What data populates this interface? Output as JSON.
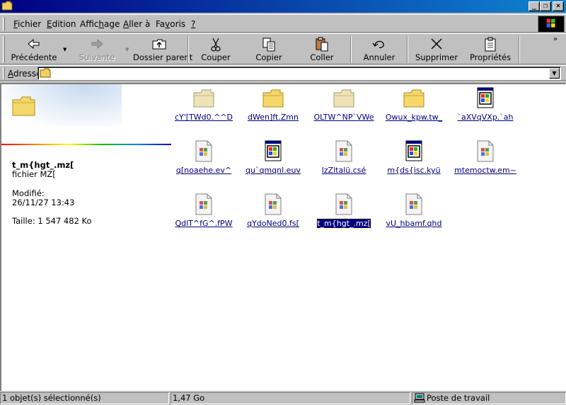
{
  "menu": {
    "items": [
      {
        "pre": "",
        "u": "F",
        "post": "ichier"
      },
      {
        "pre": "",
        "u": "E",
        "post": "dition"
      },
      {
        "pre": "Affic",
        "u": "h",
        "post": "age"
      },
      {
        "pre": "",
        "u": "A",
        "post": "ller à"
      },
      {
        "pre": "Fa",
        "u": "v",
        "post": "oris"
      },
      {
        "pre": "",
        "u": "?",
        "post": ""
      }
    ]
  },
  "toolbar": {
    "back": "Précédente",
    "forward": "Suivante",
    "up": "Dossier parent",
    "cut": "Couper",
    "copy": "Copier",
    "paste": "Coller",
    "undo": "Annuler",
    "delete": "Supprimer",
    "properties": "Propriétés"
  },
  "address": {
    "label_pre": "A",
    "label_post": "dresse",
    "value": ""
  },
  "panel": {
    "file_name": "t_m{hgt_.mz[",
    "file_type": "fichier MZ[",
    "modified_label": "Modifié:",
    "modified_value": "26/11/27 13:43",
    "size": "Taille: 1 547 482 Ko"
  },
  "files": [
    {
      "name": "cY'[TWd0.^^D",
      "kind": "folder"
    },
    {
      "name": "dWen]ft.Zmn",
      "kind": "folder-open"
    },
    {
      "name": "OLTW^NP`VWe",
      "kind": "folder"
    },
    {
      "name": "Owux_kpw.tw_",
      "kind": "folder-open"
    },
    {
      "name": "`aXVqVXp.`ah",
      "kind": "app"
    },
    {
      "name": "q[noaehe.ev^",
      "kind": "doc"
    },
    {
      "name": "qu`qmqnl.euv",
      "kind": "app"
    },
    {
      "name": "lzZltalü.csé",
      "kind": "doc"
    },
    {
      "name": "m{ds{isc.kyü",
      "kind": "app"
    },
    {
      "name": "mtemoctw.em~",
      "kind": "doc"
    },
    {
      "name": "QdlT^fG^.fPW",
      "kind": "doc"
    },
    {
      "name": "qYdoNed0.fs[",
      "kind": "doc"
    },
    {
      "name": "t_m{hgt_.mz[",
      "kind": "doc",
      "selected": true
    },
    {
      "name": "vU_hbamf.qhd",
      "kind": "doc"
    }
  ],
  "status": {
    "selection": "1 objet(s) sélectionné(s)",
    "size": "1,47 Go",
    "zone": "Poste de travail"
  }
}
